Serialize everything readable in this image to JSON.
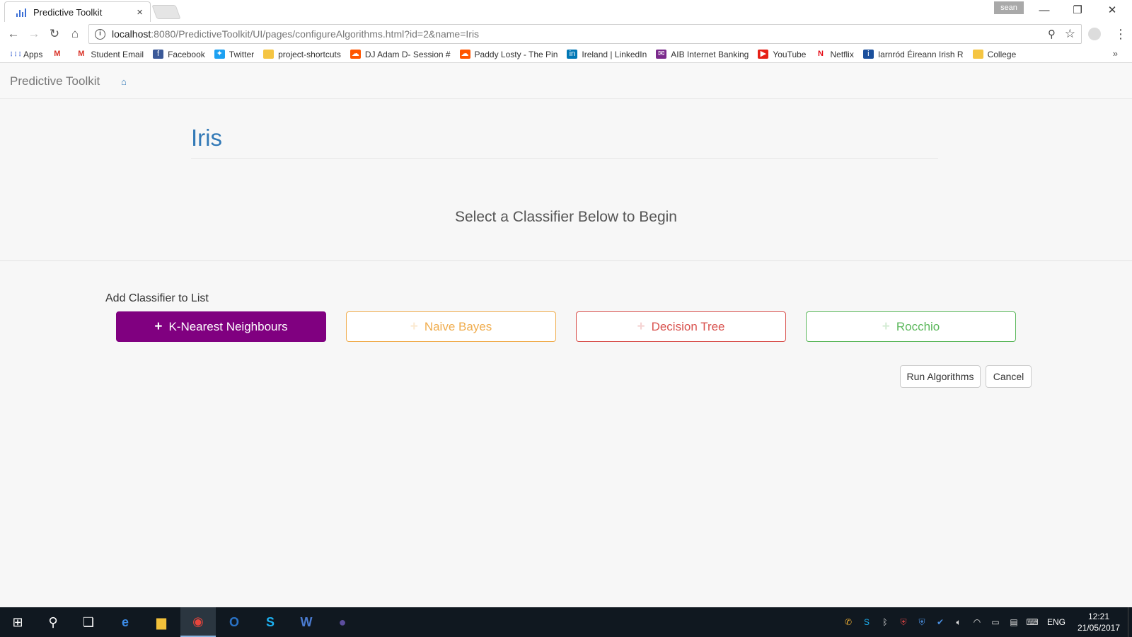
{
  "browser": {
    "tab_title": "Predictive Toolkit",
    "tab_close": "×",
    "profile_name": "sean",
    "url_host": "localhost",
    "url_rest": ":8080/PredictiveToolkit/UI/pages/configureAlgorithms.html?id=2&name=Iris",
    "info_glyph": "i",
    "bookmarks": [
      {
        "label": "Apps",
        "icon": "apps-grid-icon",
        "color": "#4a6fd6"
      },
      {
        "label": "",
        "icon": "gmail-icon",
        "color": "#d93025"
      },
      {
        "label": "Student Email",
        "icon": "gmail-icon",
        "color": "#d93025"
      },
      {
        "label": "Facebook",
        "icon": "facebook-icon",
        "color": "#3b5998"
      },
      {
        "label": "Twitter",
        "icon": "twitter-icon",
        "color": "#1da1f2"
      },
      {
        "label": "project-shortcuts",
        "icon": "folder-icon",
        "color": "#f5c542"
      },
      {
        "label": "DJ Adam D- Session #",
        "icon": "soundcloud-icon",
        "color": "#ff5500"
      },
      {
        "label": "Paddy Losty - The Pin",
        "icon": "soundcloud-icon",
        "color": "#ff5500"
      },
      {
        "label": "Ireland | LinkedIn",
        "icon": "linkedin-icon",
        "color": "#0077b5"
      },
      {
        "label": "AIB Internet Banking",
        "icon": "aib-icon",
        "color": "#7b2a8c"
      },
      {
        "label": "YouTube",
        "icon": "youtube-icon",
        "color": "#e62117"
      },
      {
        "label": "Netflix",
        "icon": "netflix-icon",
        "color": "#e50914"
      },
      {
        "label": "Iarnród Éireann Irish R",
        "icon": "irish-rail-icon",
        "color": "#1a4f9c"
      },
      {
        "label": "College",
        "icon": "folder-icon",
        "color": "#f5c542"
      }
    ],
    "more_glyph": "»"
  },
  "navbar": {
    "brand": "Predictive Toolkit",
    "home_glyph": "⌂"
  },
  "page": {
    "title": "Iris",
    "lead": "Select a Classifier Below to Begin",
    "add_label": "Add Classifier to List",
    "plus": "+",
    "classifiers": [
      {
        "label": "K-Nearest Neighbours",
        "color": "#800080",
        "selected": true
      },
      {
        "label": "Naive Bayes",
        "color": "#f0ad4e",
        "selected": false
      },
      {
        "label": "Decision Tree",
        "color": "#d9534f",
        "selected": false
      },
      {
        "label": "Rocchio",
        "color": "#5cb85c",
        "selected": false
      }
    ],
    "run_label": "Run Algorithms",
    "cancel_label": "Cancel"
  },
  "taskbar": {
    "apps": [
      "windows-start-icon",
      "search-icon",
      "task-view-icon",
      "edge-icon",
      "file-explorer-icon",
      "chrome-icon",
      "outlook-icon",
      "skype-icon",
      "word-icon",
      "eclipse-icon"
    ],
    "language": "ENG",
    "time": "12:21",
    "date": "21/05/2017"
  }
}
